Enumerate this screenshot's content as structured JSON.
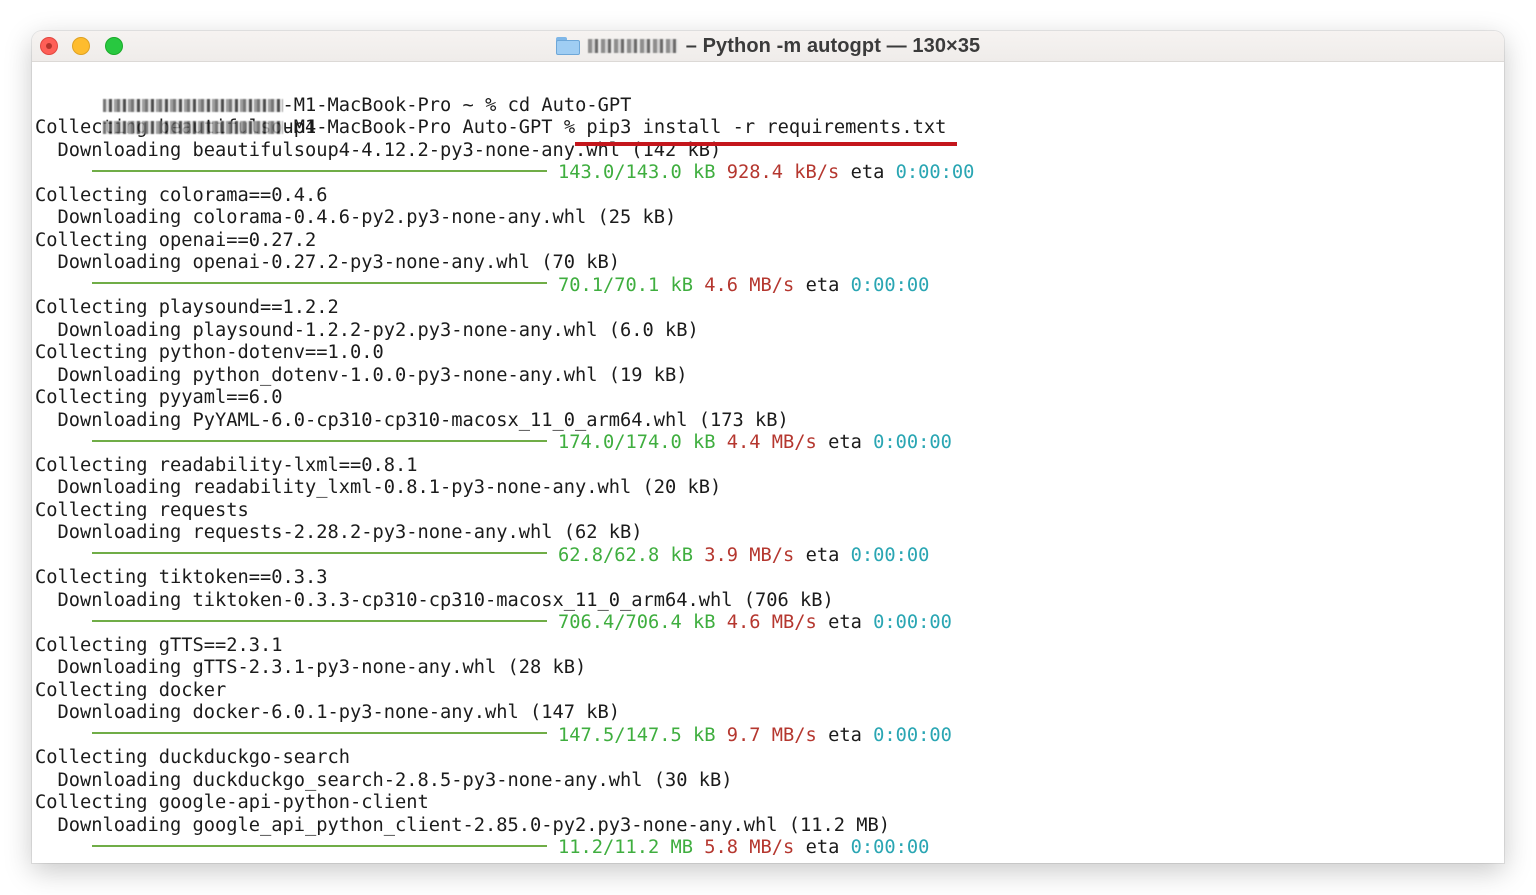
{
  "window": {
    "title": "– Python -m autogpt — 130×35"
  },
  "colors": {
    "progress_bar": "#70ad47",
    "size_text": "#3fae3f",
    "speed_text": "#b5372f",
    "eta_time": "#2aa6b3",
    "highlight_underline": "#c4161c"
  },
  "prompts": [
    {
      "host_suffix": "-M1-MacBook-Pro",
      "cwd": "~",
      "symbol": "%",
      "command": "cd Auto-GPT"
    },
    {
      "host_suffix": "-M1-MacBook-Pro",
      "cwd": "Auto-GPT",
      "symbol": "%",
      "command": "pip3 install -r requirements.txt"
    }
  ],
  "output": [
    {
      "type": "text",
      "text": "Collecting beautifulsoup4"
    },
    {
      "type": "text",
      "text": "  Downloading beautifulsoup4-4.12.2-py3-none-any.whl (142 kB)"
    },
    {
      "type": "progress",
      "size": "143.0/143.0 kB",
      "speed": "928.4 kB/s",
      "eta_label": "eta",
      "eta": "0:00:00"
    },
    {
      "type": "text",
      "text": "Collecting colorama==0.4.6"
    },
    {
      "type": "text",
      "text": "  Downloading colorama-0.4.6-py2.py3-none-any.whl (25 kB)"
    },
    {
      "type": "text",
      "text": "Collecting openai==0.27.2"
    },
    {
      "type": "text",
      "text": "  Downloading openai-0.27.2-py3-none-any.whl (70 kB)"
    },
    {
      "type": "progress",
      "size": "70.1/70.1 kB",
      "speed": "4.6 MB/s",
      "eta_label": "eta",
      "eta": "0:00:00"
    },
    {
      "type": "text",
      "text": "Collecting playsound==1.2.2"
    },
    {
      "type": "text",
      "text": "  Downloading playsound-1.2.2-py2.py3-none-any.whl (6.0 kB)"
    },
    {
      "type": "text",
      "text": "Collecting python-dotenv==1.0.0"
    },
    {
      "type": "text",
      "text": "  Downloading python_dotenv-1.0.0-py3-none-any.whl (19 kB)"
    },
    {
      "type": "text",
      "text": "Collecting pyyaml==6.0"
    },
    {
      "type": "text",
      "text": "  Downloading PyYAML-6.0-cp310-cp310-macosx_11_0_arm64.whl (173 kB)"
    },
    {
      "type": "progress",
      "size": "174.0/174.0 kB",
      "speed": "4.4 MB/s",
      "eta_label": "eta",
      "eta": "0:00:00"
    },
    {
      "type": "text",
      "text": "Collecting readability-lxml==0.8.1"
    },
    {
      "type": "text",
      "text": "  Downloading readability_lxml-0.8.1-py3-none-any.whl (20 kB)"
    },
    {
      "type": "text",
      "text": "Collecting requests"
    },
    {
      "type": "text",
      "text": "  Downloading requests-2.28.2-py3-none-any.whl (62 kB)"
    },
    {
      "type": "progress",
      "size": "62.8/62.8 kB",
      "speed": "3.9 MB/s",
      "eta_label": "eta",
      "eta": "0:00:00"
    },
    {
      "type": "text",
      "text": "Collecting tiktoken==0.3.3"
    },
    {
      "type": "text",
      "text": "  Downloading tiktoken-0.3.3-cp310-cp310-macosx_11_0_arm64.whl (706 kB)"
    },
    {
      "type": "progress",
      "size": "706.4/706.4 kB",
      "speed": "4.6 MB/s",
      "eta_label": "eta",
      "eta": "0:00:00"
    },
    {
      "type": "text",
      "text": "Collecting gTTS==2.3.1"
    },
    {
      "type": "text",
      "text": "  Downloading gTTS-2.3.1-py3-none-any.whl (28 kB)"
    },
    {
      "type": "text",
      "text": "Collecting docker"
    },
    {
      "type": "text",
      "text": "  Downloading docker-6.0.1-py3-none-any.whl (147 kB)"
    },
    {
      "type": "progress",
      "size": "147.5/147.5 kB",
      "speed": "9.7 MB/s",
      "eta_label": "eta",
      "eta": "0:00:00"
    },
    {
      "type": "text",
      "text": "Collecting duckduckgo-search"
    },
    {
      "type": "text",
      "text": "  Downloading duckduckgo_search-2.8.5-py3-none-any.whl (30 kB)"
    },
    {
      "type": "text",
      "text": "Collecting google-api-python-client"
    },
    {
      "type": "text",
      "text": "  Downloading google_api_python_client-2.85.0-py2.py3-none-any.whl (11.2 MB)"
    },
    {
      "type": "progress",
      "size": "11.2/11.2 MB",
      "speed": "5.8 MB/s",
      "eta_label": "eta",
      "eta": "0:00:00"
    }
  ]
}
